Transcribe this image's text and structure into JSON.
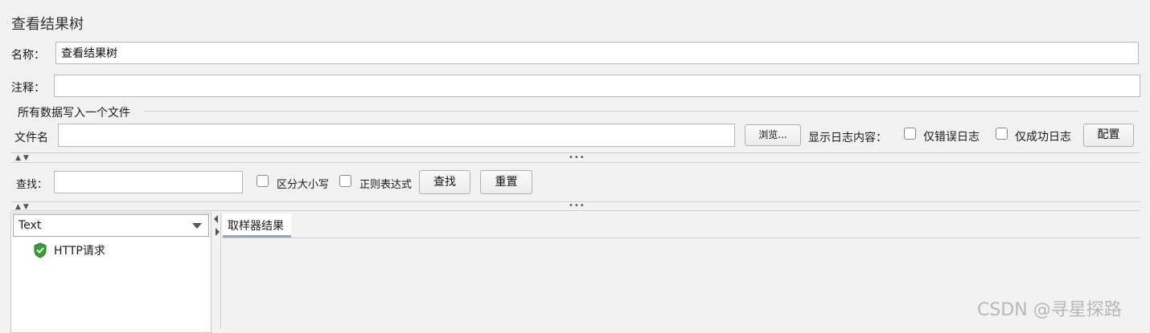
{
  "panel_title": "查看结果树",
  "name": {
    "label": "名称：",
    "value": "查看结果树"
  },
  "comment": {
    "label": "注释：",
    "value": ""
  },
  "file_section": {
    "legend": "所有数据写入一个文件",
    "filename_label": "文件名",
    "filename_value": "",
    "browse_label": "浏览...",
    "log_display_label": "显示日志内容：",
    "errors_only_label": "仅错误日志",
    "success_only_label": "仅成功日志",
    "configure_label": "配置"
  },
  "search": {
    "label": "查找：",
    "value": "",
    "case_sensitive_label": "区分大小写",
    "regex_label": "正则表达式",
    "find_label": "查找",
    "reset_label": "重置"
  },
  "renderer": {
    "selected": "Text"
  },
  "tree": {
    "items": [
      {
        "label": "HTTP请求",
        "status": "success"
      }
    ]
  },
  "result_tabs": [
    {
      "label": "取样器结果",
      "active": true
    }
  ],
  "watermark": "CSDN @寻星探路"
}
